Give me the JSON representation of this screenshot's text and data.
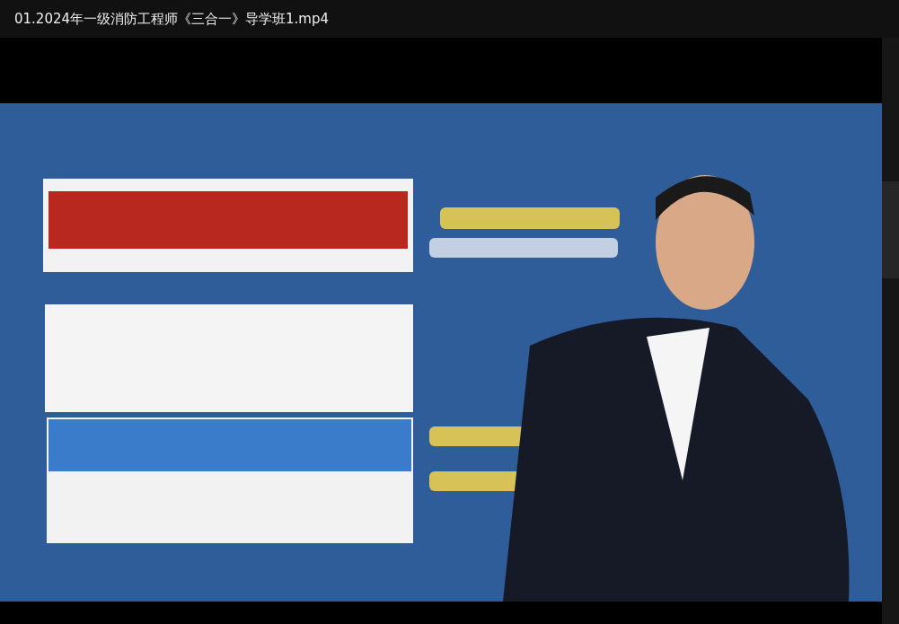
{
  "window": {
    "title": "01.2024年一级消防工程师《三合一》导学班1.mp4"
  }
}
